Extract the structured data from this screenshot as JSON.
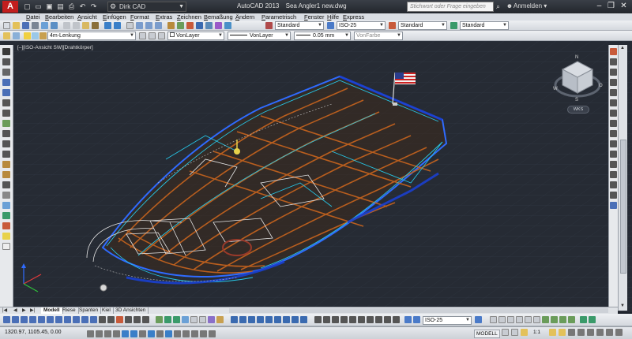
{
  "titlebar": {
    "app_logo": "A",
    "workspace": "Dirk CAD",
    "app_name": "AutoCAD 2013",
    "document": "Sea Angler1 new.dwg",
    "search_placeholder": "Stichwort oder Frage eingeben",
    "login": "Anmelden",
    "window_buttons": [
      "–",
      "❐",
      "✕"
    ]
  },
  "menu": [
    "Datei",
    "Bearbeiten",
    "Ansicht",
    "Einfügen",
    "Format",
    "Extras",
    "Zeichnen",
    "Bemaßung",
    "Ändern",
    "Parametrisch",
    "Fenster",
    "Hilfe",
    "Express"
  ],
  "toolbar1": {
    "text_style": "Standard",
    "dim_style": "ISO-25",
    "table_style": "Standard",
    "mleader_style": "Standard"
  },
  "toolbar2": {
    "layer": "4m-Lenkung",
    "color": "VonLayer",
    "linetype": "VonLayer",
    "lineweight": "0.05 mm",
    "plotstyle": "VonFarbe"
  },
  "viewport": {
    "label": "[–][ISO-Ansicht SW][Drahtkörper]",
    "viewcube_wcs": "WKS",
    "compass": [
      "N",
      "O",
      "S",
      "W"
    ]
  },
  "layout_tabs": {
    "nav": [
      "|◀",
      "◀",
      "▶",
      "▶|"
    ],
    "tabs": [
      "Modell",
      "Riese",
      "Spanten",
      "Kiel",
      "3D Ansichten"
    ],
    "active": "Modell"
  },
  "toolbar3": {
    "dim_style": "ISO-25"
  },
  "statusbar": {
    "coordinates": "1320.97, 1105.45, 0.00",
    "model": "MODELL",
    "scale": "1:1"
  },
  "colors": {
    "title_bg": "#2b2f36",
    "drawing_bg": "#262b34",
    "hull_orange": "#c8641e",
    "wire_blue": "#2f6bff",
    "wire_cyan": "#26c6e6",
    "app_red": "#c21e1e"
  }
}
